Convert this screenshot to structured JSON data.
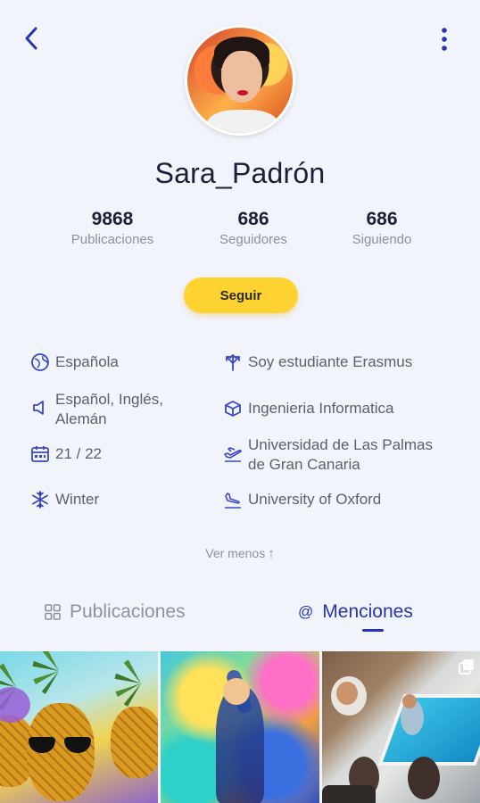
{
  "profile": {
    "username": "Sara_Padrón",
    "follow_label": "Seguir"
  },
  "stats": [
    {
      "value": "9868",
      "label": "Publicaciones"
    },
    {
      "value": "686",
      "label": "Seguidores"
    },
    {
      "value": "686",
      "label": "Siguiendo"
    }
  ],
  "info": {
    "nationality": "Española",
    "status": "Soy estudiante Erasmus",
    "languages": "Español, Inglés, Alemán",
    "degree": "Ingenieria Informatica",
    "period": "21 / 22",
    "home_university": "Universidad de Las Palmas de Gran Canaria",
    "season": "Winter",
    "host_university": "University of Oxford"
  },
  "see_less": {
    "label": "Ver menos",
    "arrow": "↑"
  },
  "tabs": [
    {
      "label": "Publicaciones",
      "active": false,
      "icon": "grid-icon"
    },
    {
      "label": "Menciones",
      "active": true,
      "icon": "at-icon"
    }
  ],
  "colors": {
    "accent": "#2933b5",
    "follow_button": "#fdd231",
    "icon_blue": "#3b48c6"
  }
}
